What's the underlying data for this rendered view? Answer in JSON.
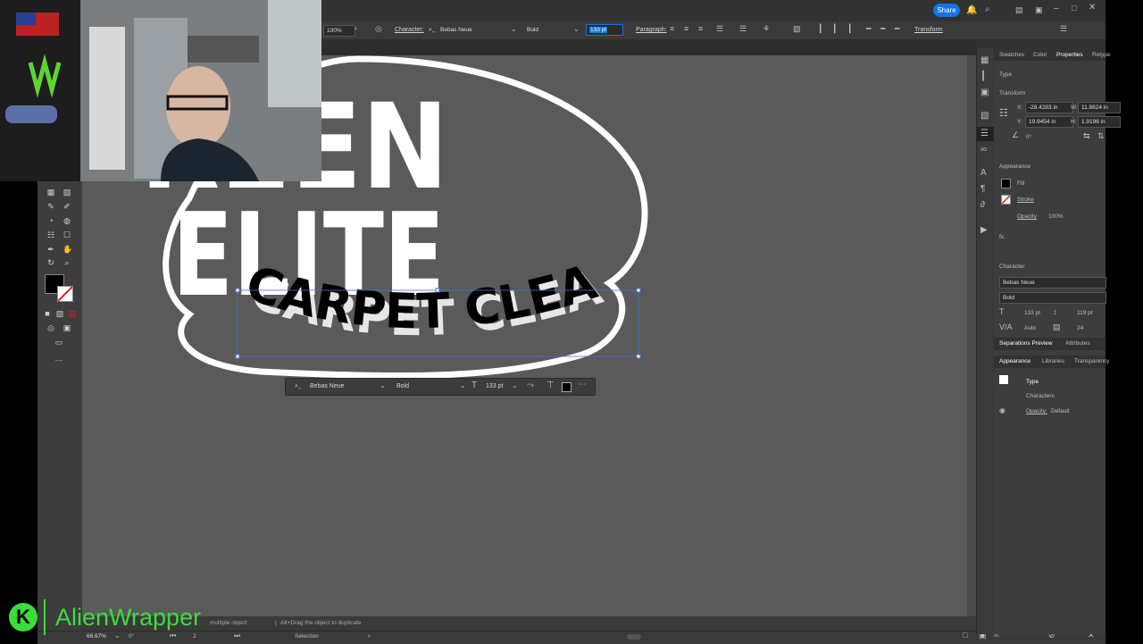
{
  "menubar": {
    "share_label": "Share"
  },
  "control_bar": {
    "zoom": "100%",
    "character_label": "Character:",
    "font_family": "Bebas Neue",
    "font_style": "Bold",
    "font_size": "133 pt",
    "paragraph_label": "Paragraph:",
    "transform_label": "Transform"
  },
  "artwork": {
    "line1": "REEN",
    "line2": "ELITE",
    "line3": "CARPET CLEANING"
  },
  "context_bar": {
    "font_family": "Bebas Neue",
    "font_style": "Bold",
    "font_size": "133 pt"
  },
  "status": {
    "zoom": "66.67%",
    "rotation": "0°",
    "artboard": "2",
    "tool": "Selection",
    "hint_prefix": "multiple object",
    "hint": "Alt+Drag the object to duplicate"
  },
  "panel": {
    "tabs": [
      "Swatches",
      "Color",
      "Properties",
      "Retype"
    ],
    "active_tab": "Properties",
    "section_type": "Type",
    "transform_label": "Transform",
    "x_label": "X:",
    "x_value": "-28.4283 in",
    "y_label": "Y:",
    "y_value": "19.9454 in",
    "w_label": "W:",
    "w_value": "11.8624 in",
    "h_label": "H:",
    "h_value": "1.9196 in",
    "angle": "0°",
    "appearance_label": "Appearance",
    "fill_label": "Fill",
    "stroke_label": "Stroke",
    "opacity_label": "Opacity",
    "opacity_value": "100%",
    "fx_label": "fx.",
    "character_label": "Character",
    "font_family": "Bebas Neue",
    "font_style": "Bold",
    "font_size": "133 pt",
    "leading": "119 pt",
    "kerning": "Auto",
    "tracking": "24"
  },
  "panel2": {
    "tabs": [
      "Separations Preview",
      "Attributes"
    ],
    "active_tab": "Separations Preview"
  },
  "panel3": {
    "tabs": [
      "Appearance",
      "Libraries",
      "Transparency"
    ],
    "active_tab": "Appearance",
    "type_label": "Type",
    "characters_label": "Characters",
    "opacity_label": "Opacity:",
    "opacity_value": "Default"
  },
  "watermark": {
    "logo_letter": "K",
    "name": "AlienWrapper"
  },
  "colors": {
    "accent": "#1473e6",
    "canvas": "#5a5a5a",
    "ui_bg": "#323232",
    "watermark": "#3ddc3d"
  }
}
